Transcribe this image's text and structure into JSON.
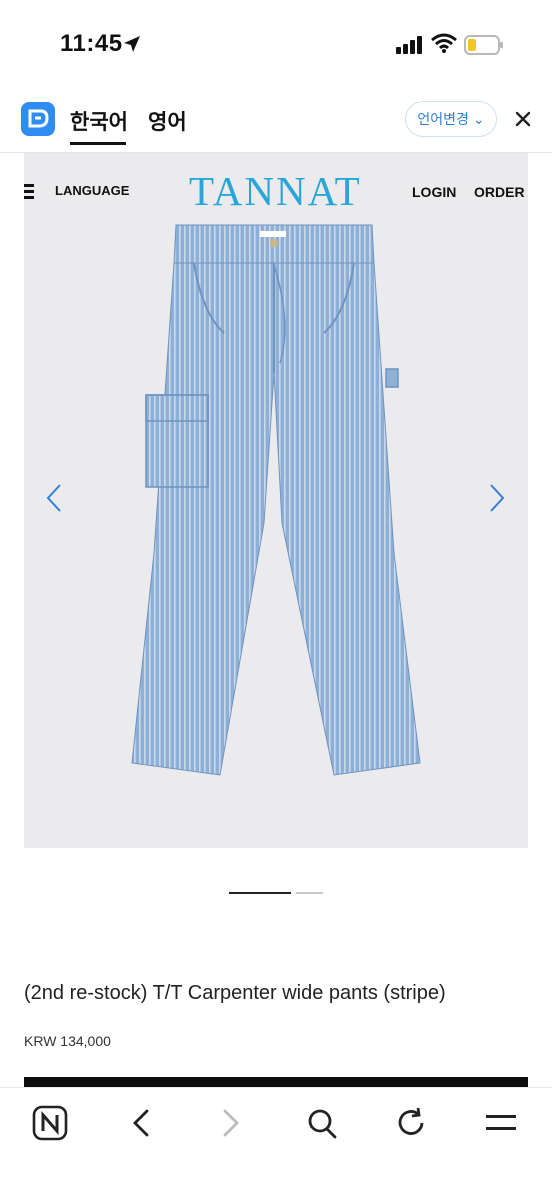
{
  "status_bar": {
    "time": "11:45"
  },
  "translate_bar": {
    "tabs": [
      "한국어",
      "영어"
    ],
    "change_language": "언어변경",
    "change_language_chevron": "⌄"
  },
  "site": {
    "brand": "TANNAT",
    "nav": {
      "language": "LANGUAGE",
      "login": "LOGIN",
      "order": "ORDER"
    }
  },
  "product": {
    "title": "(2nd re-stock) T/T Carpenter wide pants (stripe)",
    "price": "KRW 134,000",
    "image_alt": "striped denim carpenter wide pants"
  },
  "carousel": {
    "slide_count": 2,
    "active_index": 0
  },
  "colors": {
    "brand": "#2aa6d6",
    "accent_blue": "#2f7fd8",
    "denim": "#8fb0d6"
  },
  "icons": {
    "toolbar": [
      "naver-icon",
      "back-icon",
      "forward-icon",
      "search-icon",
      "refresh-icon",
      "menu-icon"
    ]
  }
}
